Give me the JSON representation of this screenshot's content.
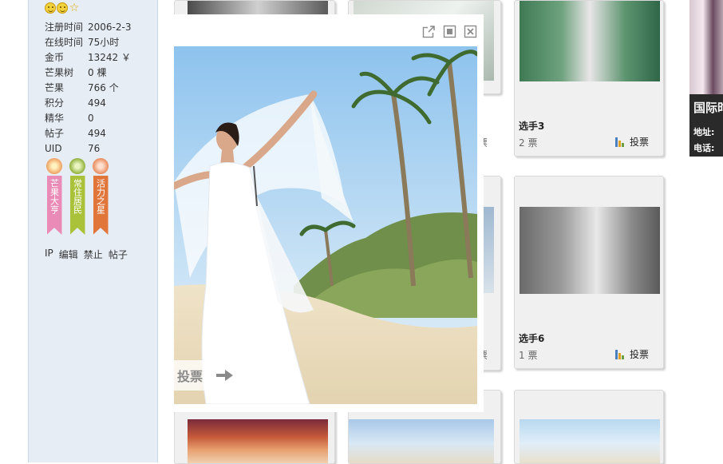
{
  "profile": {
    "stats": [
      {
        "label": "注册时间",
        "value": "2006-2-3"
      },
      {
        "label": "在线时间",
        "value": "75小时"
      },
      {
        "label": "金币",
        "value": "13242 ￥"
      },
      {
        "label": "芒果树",
        "value": "0 棵"
      },
      {
        "label": "芒果",
        "value": "766 个"
      },
      {
        "label": "积分",
        "value": "494"
      },
      {
        "label": "精华",
        "value": "0"
      },
      {
        "label": "帖子",
        "value": "494"
      },
      {
        "label": "UID",
        "value": "76"
      }
    ],
    "medals": [
      {
        "text": "芒果大亨",
        "color": "#e98bb6",
        "disc": "#f0a060"
      },
      {
        "text": "常住居民",
        "color": "#a9c23a",
        "disc": "#8fb03a"
      },
      {
        "text": "活力之星",
        "color": "#e0763a",
        "disc": "#e88b5a"
      }
    ],
    "links": [
      "IP",
      "编辑",
      "禁止",
      "帖子"
    ]
  },
  "cards": [
    {
      "name": "选手3",
      "votes": "2 票",
      "vote_label": "投票"
    },
    {
      "name": "选手6",
      "votes": "1 票",
      "vote_label": "投票"
    }
  ],
  "background_vote_fragments": [
    "票",
    "票"
  ],
  "ad": {
    "title": "国际时",
    "addr": "地址:",
    "phone": "电话:"
  },
  "lightbox": {
    "vote_label": "投票"
  },
  "colors": {
    "sidebar_bg": "#e6edf5",
    "card_bg": "#f0f0f0"
  }
}
